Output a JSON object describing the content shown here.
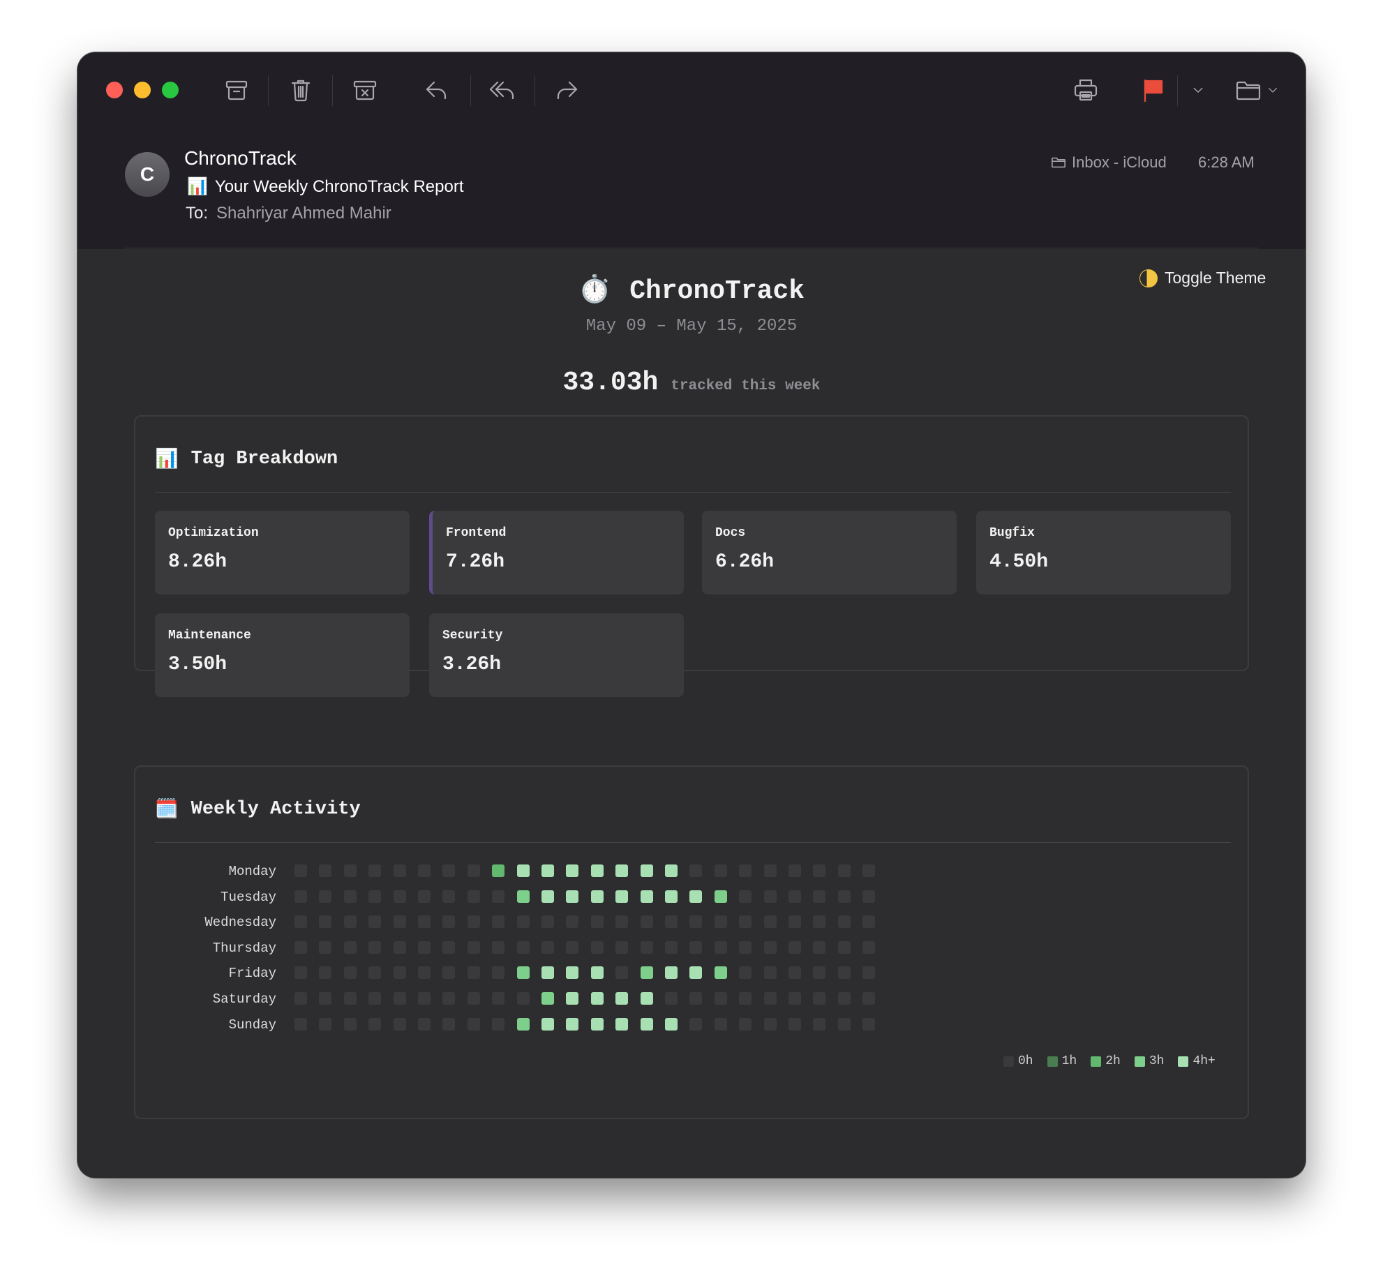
{
  "toolbar": {
    "buttons": [
      "archive-icon",
      "trash-icon",
      "junk-icon",
      "reply-icon",
      "reply-all-icon",
      "forward-icon",
      "print-icon",
      "flag-icon",
      "move-to-folder-icon"
    ],
    "flag_color": "#eb4d3d"
  },
  "message": {
    "avatar_initial": "C",
    "sender": "ChronoTrack",
    "subject_emoji": "📊",
    "subject": "Your Weekly ChronoTrack Report",
    "to_label": "To:",
    "to_value": "Shahriyar Ahmed Mahir",
    "mailbox": "Inbox - iCloud",
    "time": "6:28 AM"
  },
  "report": {
    "toggle_theme": "Toggle Theme",
    "title_icon": "⏱️",
    "title": "ChronoTrack",
    "date_range": "May 09 – May 15, 2025",
    "total_hours": "33.03h",
    "total_suffix": "tracked this week",
    "tag_section": {
      "icon": "📊",
      "title": "Tag Breakdown",
      "tags": [
        {
          "name": "Optimization",
          "value": "8.26h"
        },
        {
          "name": "Frontend",
          "value": "7.26h"
        },
        {
          "name": "Docs",
          "value": "6.26h"
        },
        {
          "name": "Bugfix",
          "value": "4.50h"
        },
        {
          "name": "Maintenance",
          "value": "3.50h"
        },
        {
          "name": "Security",
          "value": "3.26h"
        }
      ]
    },
    "activity_section": {
      "icon": "🗓️",
      "title": "Weekly Activity",
      "days": [
        "Monday",
        "Tuesday",
        "Wednesday",
        "Thursday",
        "Friday",
        "Saturday",
        "Sunday"
      ],
      "levels": [
        [
          0,
          0,
          0,
          0,
          0,
          0,
          0,
          0,
          2,
          4,
          4,
          4,
          4,
          4,
          4,
          4,
          0,
          0,
          0,
          0,
          0,
          0,
          0,
          0
        ],
        [
          0,
          0,
          0,
          0,
          0,
          0,
          0,
          0,
          0,
          3,
          4,
          4,
          4,
          4,
          4,
          4,
          4,
          3,
          0,
          0,
          0,
          0,
          0,
          0
        ],
        [
          0,
          0,
          0,
          0,
          0,
          0,
          0,
          0,
          0,
          0,
          0,
          0,
          0,
          0,
          0,
          0,
          0,
          0,
          0,
          0,
          0,
          0,
          0,
          0
        ],
        [
          0,
          0,
          0,
          0,
          0,
          0,
          0,
          0,
          0,
          0,
          0,
          0,
          0,
          0,
          0,
          0,
          0,
          0,
          0,
          0,
          0,
          0,
          0,
          0
        ],
        [
          0,
          0,
          0,
          0,
          0,
          0,
          0,
          0,
          0,
          3,
          4,
          4,
          4,
          0,
          3,
          4,
          4,
          3,
          0,
          0,
          0,
          0,
          0,
          0
        ],
        [
          0,
          0,
          0,
          0,
          0,
          0,
          0,
          0,
          0,
          0,
          3,
          4,
          4,
          4,
          4,
          0,
          0,
          0,
          0,
          0,
          0,
          0,
          0,
          0
        ],
        [
          0,
          0,
          0,
          0,
          0,
          0,
          0,
          0,
          0,
          3,
          4,
          4,
          4,
          4,
          4,
          4,
          0,
          0,
          0,
          0,
          0,
          0,
          0,
          0
        ]
      ],
      "legend": [
        "0h",
        "1h",
        "2h",
        "3h",
        "4h+"
      ],
      "level_colors": [
        "#3a3a3c",
        "#4a7d50",
        "#62b86e",
        "#7ecf8c",
        "#a8e0b4"
      ]
    }
  }
}
